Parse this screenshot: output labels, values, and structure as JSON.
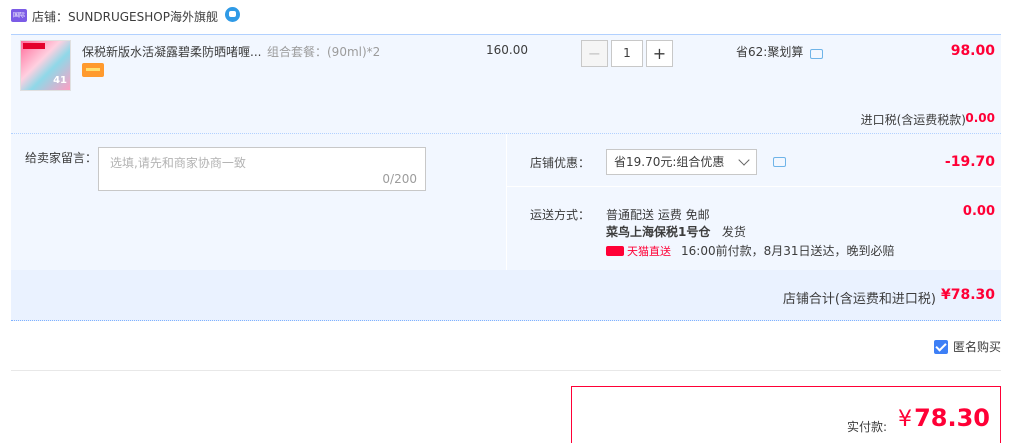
{
  "shop": {
    "badge_text": "国际",
    "label": "店铺：",
    "name": "SUNDRUGESHOP海外旗舰"
  },
  "item": {
    "title": "保税新版水活凝露碧柔防晒啫喱...",
    "sku": "组合套餐：(90ml)*2",
    "price": "160.00",
    "quantity": "1",
    "promo": "省62:聚划算",
    "total": "98.00",
    "thumb_number": "41",
    "tax_label": "进口税(含运费税款)",
    "tax_value": "0.00"
  },
  "message": {
    "label": "给卖家留言：",
    "placeholder": "选填,请先和商家协商一致",
    "count": "0/200"
  },
  "discount": {
    "label": "店铺优惠：",
    "selected": "省19.70元:组合优惠",
    "value": "-19.70"
  },
  "shipping": {
    "label": "运送方式：",
    "method": "普通配送 运费 免邮",
    "warehouse": "菜鸟上海保税1号仓",
    "dispatch": "发货",
    "tag": "天猫直送",
    "promise": "16:00前付款，8月31日送达，晚到必赔",
    "value": "0.00"
  },
  "store_total": {
    "label": "店铺合计(含运费和进口税)",
    "value": "¥78.30"
  },
  "anonymous": {
    "label": "匿名购买",
    "checked": true
  },
  "payment": {
    "label": "实付款:",
    "currency": "¥",
    "value": "78.30"
  },
  "colors": {
    "accent_red": "#ff0036",
    "panel_blue": "#f2f7ff",
    "checkbox_blue": "#3d7ff6"
  }
}
